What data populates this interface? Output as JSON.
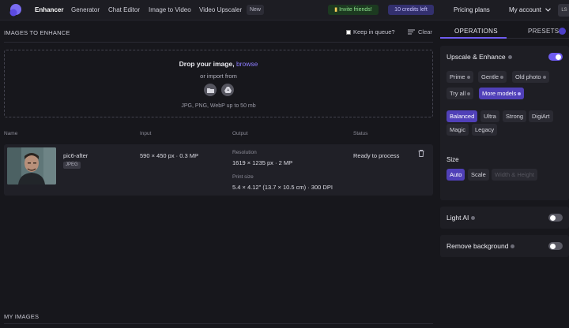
{
  "nav": {
    "items": [
      "Enhancer",
      "Generator",
      "Chat Editor",
      "Image to Video",
      "Video Upscaler"
    ],
    "new_badge": "New",
    "invite": "Invite friends!",
    "credits": "10 credits left",
    "pricing": "Pricing plans",
    "account": "My account",
    "avatar": "LS"
  },
  "queue": {
    "title": "IMAGES TO ENHANCE",
    "keep_label": "Keep in queue?",
    "clear_label": "Clear"
  },
  "dropzone": {
    "title": "Drop your image,",
    "browse": "browse",
    "import_label": "or import from",
    "formats": "JPG, PNG, WebP up to 50 mb"
  },
  "table": {
    "headers": [
      "Name",
      "Input",
      "Output",
      "Status"
    ],
    "row": {
      "name": "pic6-after",
      "type": "JPEG",
      "input": "590 × 450 px · 0.3 MP",
      "resolution_label": "Resolution",
      "resolution": "1619 × 1235 px · 2 MP",
      "print_label": "Print size",
      "print_size": "5.4 × 4.12\" (13.7 × 10.5 cm) · 300 DPI",
      "status": "Ready to process"
    }
  },
  "my_images": "MY IMAGES",
  "panel": {
    "tabs": [
      "OPERATIONS",
      "PRESETS"
    ],
    "upscale": {
      "title": "Upscale & Enhance",
      "enabled": true,
      "models": [
        "Prime",
        "Gentle",
        "Old photo",
        "Try all",
        "More models"
      ],
      "modes": [
        "Balanced",
        "Ultra",
        "Strong",
        "DigiArt",
        "Magic",
        "Legacy"
      ],
      "size_label": "Size",
      "sizes": [
        "Auto",
        "Scale",
        "Width & Height"
      ]
    },
    "light_ai": {
      "title": "Light AI",
      "enabled": false
    },
    "remove_bg": {
      "title": "Remove background",
      "enabled": false
    }
  }
}
